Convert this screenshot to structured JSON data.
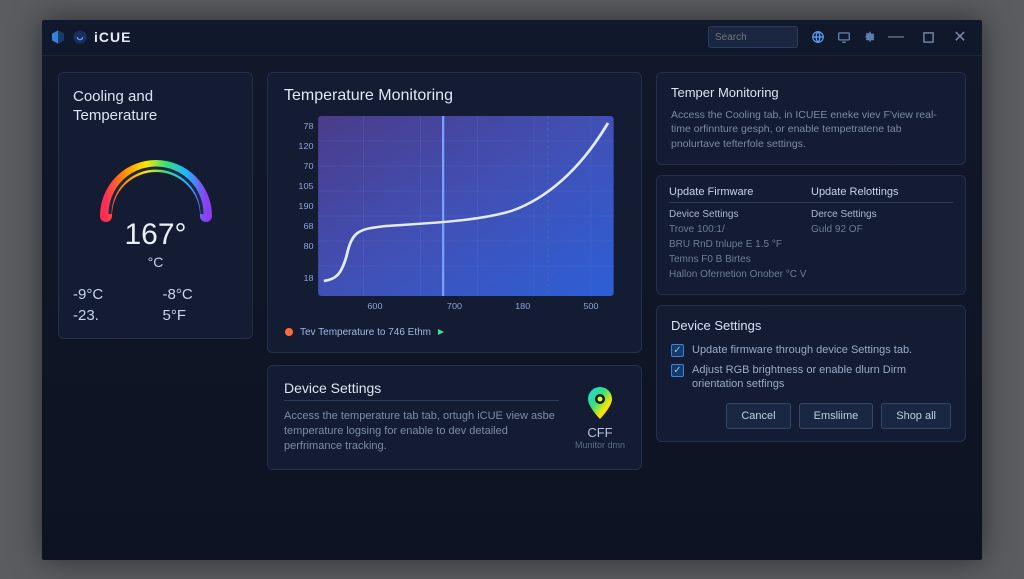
{
  "app": {
    "title": "iCUE",
    "search_placeholder": "Search"
  },
  "cooling": {
    "title": "Cooling and Temperature",
    "big_temp": "167°",
    "unit": "°C",
    "readings": [
      "-9°C",
      "-8°C",
      "-23.",
      "5°F"
    ]
  },
  "chart": {
    "title": "Temperature Monitoring",
    "legend": "Tev  Temperature to  746 Ethm"
  },
  "chart_data": {
    "type": "line",
    "x": [
      600,
      700,
      180,
      500
    ],
    "y_ticks": [
      78,
      120,
      70,
      105,
      190,
      68,
      80,
      18
    ],
    "series": [
      {
        "name": "Temperature",
        "values": [
          20,
          22,
          40,
          72,
          74,
          76,
          80,
          86,
          92,
          100,
          115,
          130,
          160,
          200
        ]
      }
    ],
    "vlines": [
      0.42,
      0.78
    ],
    "ylim": [
      0,
      200
    ]
  },
  "device_settings_left": {
    "title": "Device Settings",
    "desc": "Access the temperature tab tab, ortugh iCUE view asbe temperature logsing for enable to dev detailed perfrimance tracking.",
    "brand_label": "CFF",
    "brand_sub": "Munitor dmn"
  },
  "right_top": {
    "title": "Temper Monitoring",
    "desc": "Access the Cooling tab, in ICUEE eneke viev F'view real-time orfinnture gesph, or enable tempetratene tab pnolurtave tefterfole settings."
  },
  "table": {
    "headers": [
      "Update Firmware",
      "Update Relottings"
    ],
    "rows": [
      [
        "Device Settings",
        "Derce Settings"
      ],
      [
        "Trove 100:1/",
        "Guld 92 OF"
      ],
      [
        "BRU   RnD tnlupe E 1.5 °F",
        ""
      ],
      [
        "Temns  F0 B Birtes",
        ""
      ],
      [
        "Hallon  Ofernetion Onober °C V",
        ""
      ]
    ]
  },
  "settings_right": {
    "title": "Device Settings",
    "checks": [
      "Update firmware through device Settings tab.",
      "Adjust RGB brightness or enable dlurn Dirm orientation setfings"
    ],
    "buttons": [
      "Cancel",
      "Emsliime",
      "Shop all"
    ]
  }
}
